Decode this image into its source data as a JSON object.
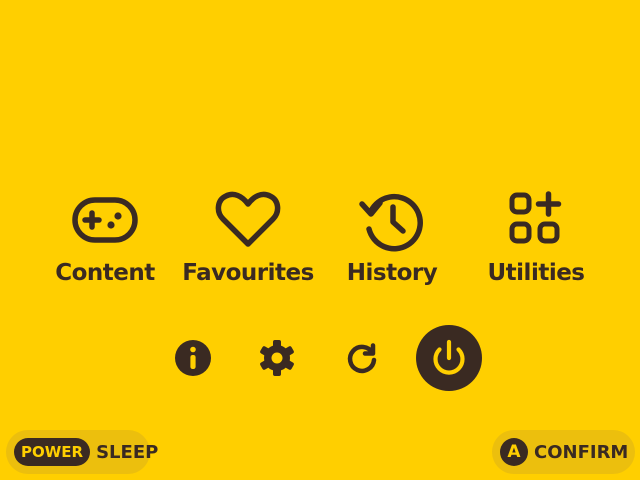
{
  "theme": {
    "background": "#FFCF00",
    "foreground": "#3a2a22",
    "pill_background": "#ECBF0D",
    "key_badge_background": "#3a2a22",
    "key_badge_text": "#FFCF00"
  },
  "menu": {
    "items": [
      {
        "label": "Content",
        "icon": "gamepad-icon"
      },
      {
        "label": "Favourites",
        "icon": "heart-icon"
      },
      {
        "label": "History",
        "icon": "history-icon"
      },
      {
        "label": "Utilities",
        "icon": "apps-grid-icon"
      }
    ]
  },
  "system_buttons": [
    {
      "name": "info",
      "icon": "info-icon"
    },
    {
      "name": "settings",
      "icon": "gear-icon"
    },
    {
      "name": "restart",
      "icon": "restart-icon"
    },
    {
      "name": "power",
      "icon": "power-icon",
      "selected": true
    }
  ],
  "footer": {
    "left": {
      "key": "POWER",
      "label": "SLEEP"
    },
    "right": {
      "key": "A",
      "label": "CONFIRM"
    }
  }
}
